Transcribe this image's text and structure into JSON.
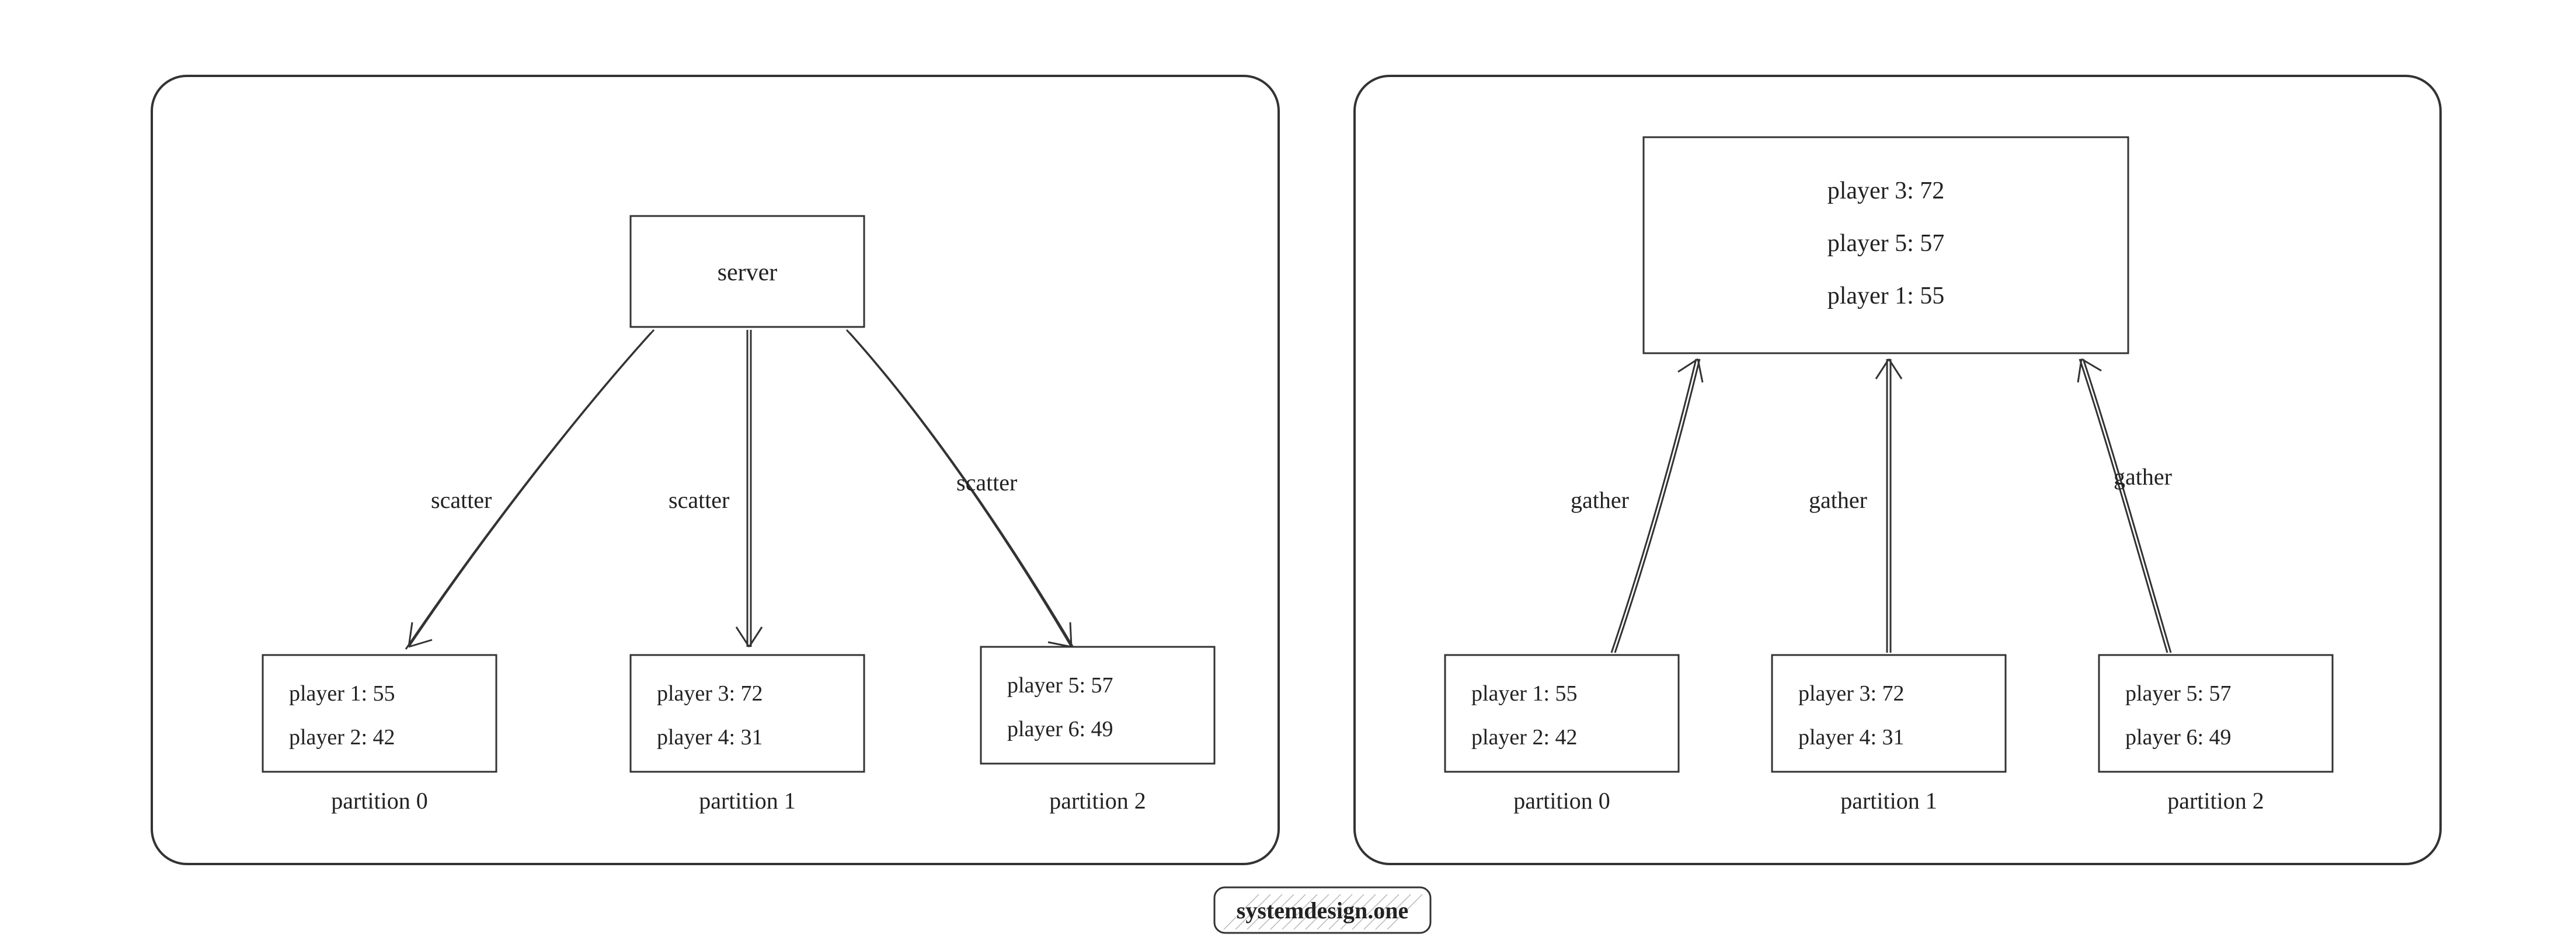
{
  "watermark": "systemdesign.one",
  "left": {
    "server_label": "server",
    "edges": {
      "e0": "scatter",
      "e1": "scatter",
      "e2": "scatter"
    },
    "partitions": [
      {
        "caption": "partition 0",
        "lines": [
          "player 1: 55",
          "player 2: 42"
        ]
      },
      {
        "caption": "partition 1",
        "lines": [
          "player 3: 72",
          "player 4: 31"
        ]
      },
      {
        "caption": "partition 2",
        "lines": [
          "player 5: 57",
          "player 6: 49"
        ]
      }
    ]
  },
  "right": {
    "result_lines": [
      "player 3: 72",
      "player 5: 57",
      "player 1: 55"
    ],
    "edges": {
      "e0": "gather",
      "e1": "gather",
      "e2": "gather"
    },
    "partitions": [
      {
        "caption": "partition 0",
        "lines": [
          "player 1: 55",
          "player 2: 42"
        ]
      },
      {
        "caption": "partition 1",
        "lines": [
          "player 3: 72",
          "player 4: 31"
        ]
      },
      {
        "caption": "partition 2",
        "lines": [
          "player 5: 57",
          "player 6: 49"
        ]
      }
    ]
  }
}
